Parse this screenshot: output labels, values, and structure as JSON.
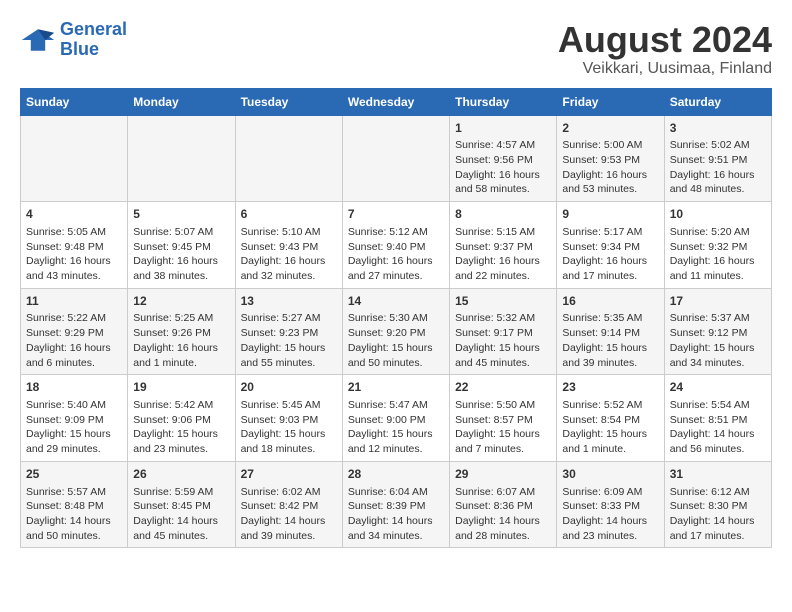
{
  "header": {
    "logo_line1": "General",
    "logo_line2": "Blue",
    "title": "August 2024",
    "subtitle": "Veikkari, Uusimaa, Finland"
  },
  "days_of_week": [
    "Sunday",
    "Monday",
    "Tuesday",
    "Wednesday",
    "Thursday",
    "Friday",
    "Saturday"
  ],
  "weeks": [
    [
      {
        "day": "",
        "content": ""
      },
      {
        "day": "",
        "content": ""
      },
      {
        "day": "",
        "content": ""
      },
      {
        "day": "",
        "content": ""
      },
      {
        "day": "1",
        "content": "Sunrise: 4:57 AM\nSunset: 9:56 PM\nDaylight: 16 hours\nand 58 minutes."
      },
      {
        "day": "2",
        "content": "Sunrise: 5:00 AM\nSunset: 9:53 PM\nDaylight: 16 hours\nand 53 minutes."
      },
      {
        "day": "3",
        "content": "Sunrise: 5:02 AM\nSunset: 9:51 PM\nDaylight: 16 hours\nand 48 minutes."
      }
    ],
    [
      {
        "day": "4",
        "content": "Sunrise: 5:05 AM\nSunset: 9:48 PM\nDaylight: 16 hours\nand 43 minutes."
      },
      {
        "day": "5",
        "content": "Sunrise: 5:07 AM\nSunset: 9:45 PM\nDaylight: 16 hours\nand 38 minutes."
      },
      {
        "day": "6",
        "content": "Sunrise: 5:10 AM\nSunset: 9:43 PM\nDaylight: 16 hours\nand 32 minutes."
      },
      {
        "day": "7",
        "content": "Sunrise: 5:12 AM\nSunset: 9:40 PM\nDaylight: 16 hours\nand 27 minutes."
      },
      {
        "day": "8",
        "content": "Sunrise: 5:15 AM\nSunset: 9:37 PM\nDaylight: 16 hours\nand 22 minutes."
      },
      {
        "day": "9",
        "content": "Sunrise: 5:17 AM\nSunset: 9:34 PM\nDaylight: 16 hours\nand 17 minutes."
      },
      {
        "day": "10",
        "content": "Sunrise: 5:20 AM\nSunset: 9:32 PM\nDaylight: 16 hours\nand 11 minutes."
      }
    ],
    [
      {
        "day": "11",
        "content": "Sunrise: 5:22 AM\nSunset: 9:29 PM\nDaylight: 16 hours\nand 6 minutes."
      },
      {
        "day": "12",
        "content": "Sunrise: 5:25 AM\nSunset: 9:26 PM\nDaylight: 16 hours\nand 1 minute."
      },
      {
        "day": "13",
        "content": "Sunrise: 5:27 AM\nSunset: 9:23 PM\nDaylight: 15 hours\nand 55 minutes."
      },
      {
        "day": "14",
        "content": "Sunrise: 5:30 AM\nSunset: 9:20 PM\nDaylight: 15 hours\nand 50 minutes."
      },
      {
        "day": "15",
        "content": "Sunrise: 5:32 AM\nSunset: 9:17 PM\nDaylight: 15 hours\nand 45 minutes."
      },
      {
        "day": "16",
        "content": "Sunrise: 5:35 AM\nSunset: 9:14 PM\nDaylight: 15 hours\nand 39 minutes."
      },
      {
        "day": "17",
        "content": "Sunrise: 5:37 AM\nSunset: 9:12 PM\nDaylight: 15 hours\nand 34 minutes."
      }
    ],
    [
      {
        "day": "18",
        "content": "Sunrise: 5:40 AM\nSunset: 9:09 PM\nDaylight: 15 hours\nand 29 minutes."
      },
      {
        "day": "19",
        "content": "Sunrise: 5:42 AM\nSunset: 9:06 PM\nDaylight: 15 hours\nand 23 minutes."
      },
      {
        "day": "20",
        "content": "Sunrise: 5:45 AM\nSunset: 9:03 PM\nDaylight: 15 hours\nand 18 minutes."
      },
      {
        "day": "21",
        "content": "Sunrise: 5:47 AM\nSunset: 9:00 PM\nDaylight: 15 hours\nand 12 minutes."
      },
      {
        "day": "22",
        "content": "Sunrise: 5:50 AM\nSunset: 8:57 PM\nDaylight: 15 hours\nand 7 minutes."
      },
      {
        "day": "23",
        "content": "Sunrise: 5:52 AM\nSunset: 8:54 PM\nDaylight: 15 hours\nand 1 minute."
      },
      {
        "day": "24",
        "content": "Sunrise: 5:54 AM\nSunset: 8:51 PM\nDaylight: 14 hours\nand 56 minutes."
      }
    ],
    [
      {
        "day": "25",
        "content": "Sunrise: 5:57 AM\nSunset: 8:48 PM\nDaylight: 14 hours\nand 50 minutes."
      },
      {
        "day": "26",
        "content": "Sunrise: 5:59 AM\nSunset: 8:45 PM\nDaylight: 14 hours\nand 45 minutes."
      },
      {
        "day": "27",
        "content": "Sunrise: 6:02 AM\nSunset: 8:42 PM\nDaylight: 14 hours\nand 39 minutes."
      },
      {
        "day": "28",
        "content": "Sunrise: 6:04 AM\nSunset: 8:39 PM\nDaylight: 14 hours\nand 34 minutes."
      },
      {
        "day": "29",
        "content": "Sunrise: 6:07 AM\nSunset: 8:36 PM\nDaylight: 14 hours\nand 28 minutes."
      },
      {
        "day": "30",
        "content": "Sunrise: 6:09 AM\nSunset: 8:33 PM\nDaylight: 14 hours\nand 23 minutes."
      },
      {
        "day": "31",
        "content": "Sunrise: 6:12 AM\nSunset: 8:30 PM\nDaylight: 14 hours\nand 17 minutes."
      }
    ]
  ]
}
